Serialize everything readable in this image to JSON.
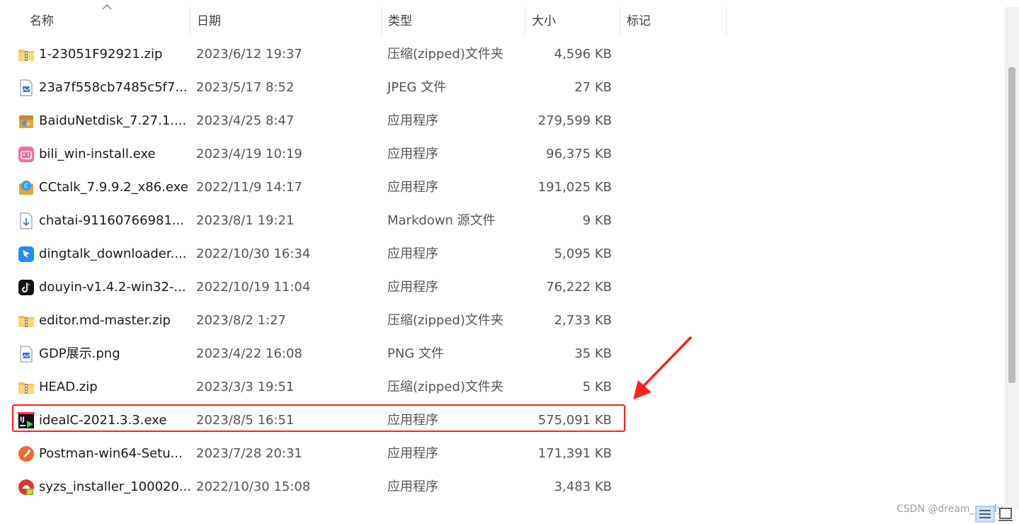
{
  "columns": {
    "name": "名称",
    "date": "日期",
    "type": "类型",
    "size": "大小",
    "tag": "标记"
  },
  "files": [
    {
      "name": "1-23051F92921.zip",
      "date": "2023/6/12 19:37",
      "type": "压缩(zipped)文件夹",
      "size": "4,596 KB",
      "icon": "zip-folder-icon"
    },
    {
      "name": "23a7f558cb7485c5f7...",
      "date": "2023/5/17 8:52",
      "type": "JPEG 文件",
      "size": "27 KB",
      "icon": "image-file-icon"
    },
    {
      "name": "BaiduNetdisk_7.27.1....",
      "date": "2023/4/25 8:47",
      "type": "应用程序",
      "size": "279,599 KB",
      "icon": "baidu-netdisk-installer-icon"
    },
    {
      "name": "bili_win-install.exe",
      "date": "2023/4/19 10:19",
      "type": "应用程序",
      "size": "96,375 KB",
      "icon": "bilibili-icon"
    },
    {
      "name": "CCtalk_7.9.9.2_x86.exe",
      "date": "2022/11/9 14:17",
      "type": "应用程序",
      "size": "191,025 KB",
      "icon": "cctalk-installer-icon"
    },
    {
      "name": "chatai-91160766981...",
      "date": "2023/8/1 19:21",
      "type": "Markdown 源文件",
      "size": "9 KB",
      "icon": "markdown-file-icon"
    },
    {
      "name": "dingtalk_downloader....",
      "date": "2022/10/30 16:34",
      "type": "应用程序",
      "size": "5,095 KB",
      "icon": "dingtalk-icon"
    },
    {
      "name": "douyin-v1.4.2-win32-...",
      "date": "2022/10/19 11:04",
      "type": "应用程序",
      "size": "76,222 KB",
      "icon": "douyin-icon"
    },
    {
      "name": "editor.md-master.zip",
      "date": "2023/8/2 1:27",
      "type": "压缩(zipped)文件夹",
      "size": "2,733 KB",
      "icon": "zip-folder-icon"
    },
    {
      "name": "GDP展示.png",
      "date": "2023/4/22 16:08",
      "type": "PNG 文件",
      "size": "35 KB",
      "icon": "image-file-icon"
    },
    {
      "name": "HEAD.zip",
      "date": "2023/3/3 19:51",
      "type": "压缩(zipped)文件夹",
      "size": "5 KB",
      "icon": "zip-folder-icon"
    },
    {
      "name": "idealC-2021.3.3.exe",
      "date": "2023/8/5 16:51",
      "type": "应用程序",
      "size": "575,091 KB",
      "icon": "intellij-idea-icon"
    },
    {
      "name": "Postman-win64-Setu...",
      "date": "2023/7/28 20:31",
      "type": "应用程序",
      "size": "171,391 KB",
      "icon": "postman-icon"
    },
    {
      "name": "syzs_installer_100020...",
      "date": "2022/10/30 15:08",
      "type": "应用程序",
      "size": "3,483 KB",
      "icon": "syzs-installer-icon"
    }
  ],
  "annotation": {
    "highlight_color": "#ff2020"
  },
  "watermark": "CSDN @dream_ready"
}
